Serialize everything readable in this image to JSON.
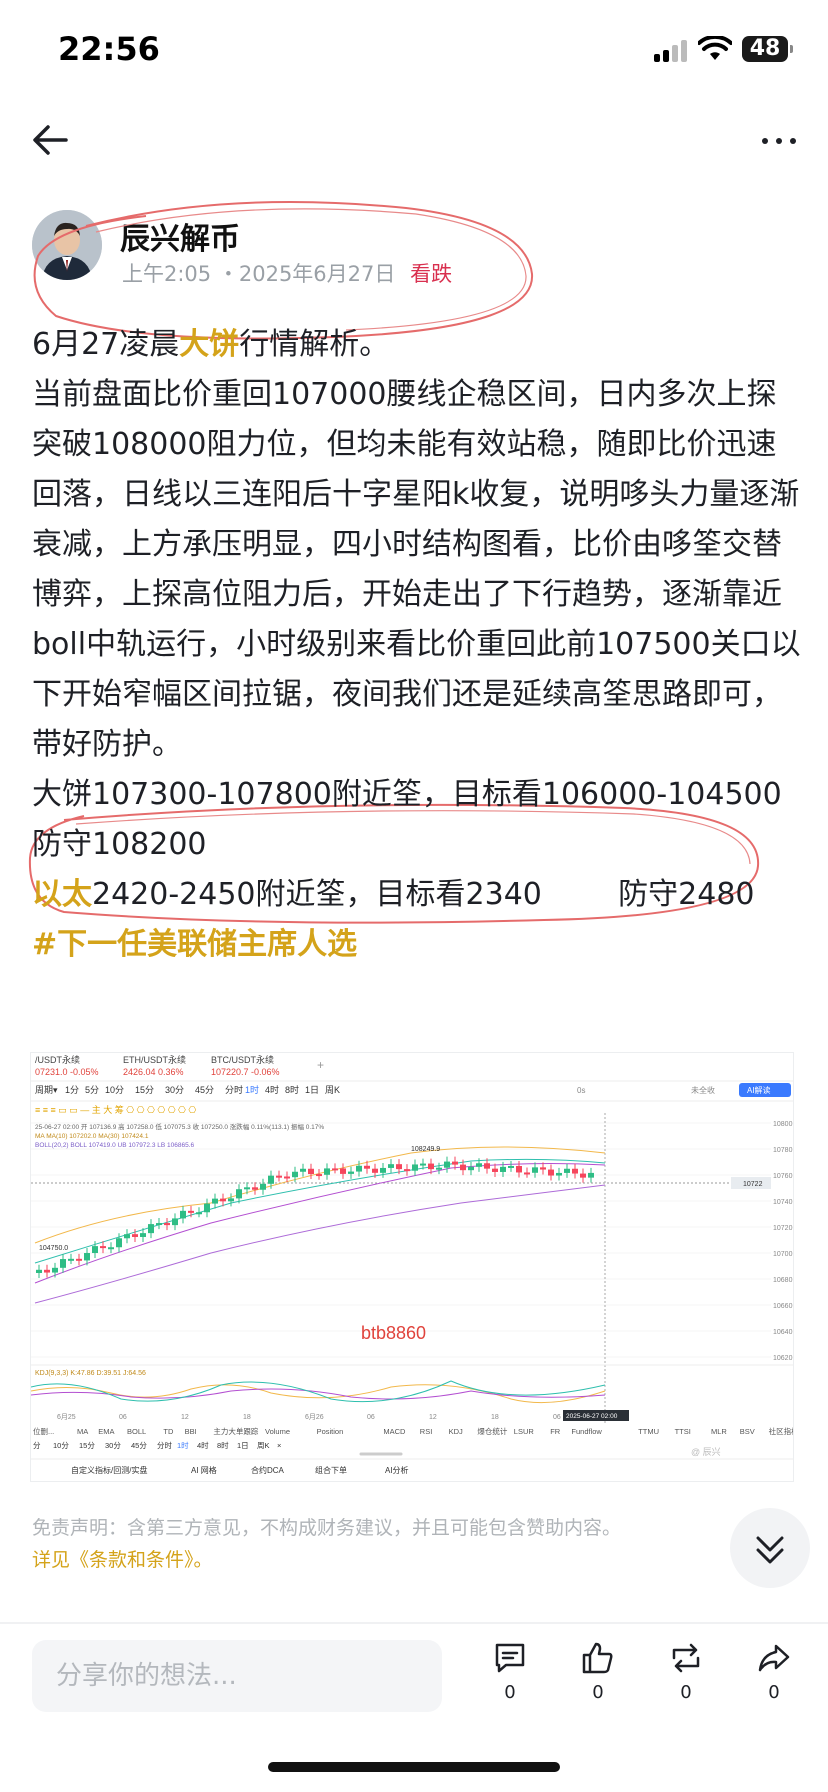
{
  "status_bar": {
    "time": "22:56",
    "battery": "48"
  },
  "author": {
    "name": "辰兴解币",
    "time": "上午2:05",
    "date": "・2025年6月27日",
    "sentiment": "看跌"
  },
  "post": {
    "title_pre": "6月27凌晨",
    "title_highlight": "大饼",
    "title_post": "行情解析。",
    "body": "当前盘面比价重回107000腰线企稳区间，日内多次上探突破108000阻力位，但均未能有效站稳，随即比价迅速回落，日线以三连阳后十字星阳k收复，说明哆头力量逐渐衰减，上方承压明显，四小时结构图看，比价由哆筌交替博弈，上探高位阻力后，开始走出了下行趋势，逐渐靠近boll中轨运行，小时级别来看比价重回此前107500关口以下开始窄幅区间拉锯，夜间我们还是延续高筌思路即可，带好防护。",
    "btc_plan": "大饼107300-107800附近筌，目标看106000-104500  防守108200",
    "eth_label": "以太",
    "eth_plan": "2420-2450附近筌，目标看2340        防守2480",
    "hashtag": "#下一任美联储主席人选"
  },
  "chart": {
    "tabs": [
      {
        "symbol": "/USDT永续",
        "price": "07231.0 -0.05%"
      },
      {
        "symbol": "ETH/USDT永续",
        "price": "2426.04 0.36%"
      },
      {
        "symbol": "BTC/USDT永续",
        "price": "107220.7 -0.06%"
      }
    ],
    "add_tab": "+",
    "timeframes": [
      "周期▾",
      "1分",
      "5分",
      "10分",
      "15分",
      "30分",
      "45分",
      "分时",
      "1时",
      "4时",
      "8时",
      "1日",
      "周K"
    ],
    "ohlc": "25-06-27 02:00   开 107136.9  高 107258.0  低 107075.3  收 107250.0  涨跌幅 0.11%(113.1)  振幅 0.17%",
    "ma_line": "MA   MA(10) 107202.0   MA(30) 107424.1",
    "boll_line": "BOLL(20,2)  BOLL 107419.0   UB 107972.3   LB 106865.6",
    "high_label": "108249.9",
    "low_label": "104750.0",
    "watermark": "btb8860",
    "price_ticks": [
      "10800",
      "10780",
      "10760",
      "10740",
      "10720",
      "10700",
      "10680",
      "10660",
      "10640",
      "10620"
    ],
    "current_price": "10722",
    "kdj_line": "KDJ(9,3,3)  K:47.86  D:39.51  J:64.56",
    "date_labels": [
      "6月25",
      "06",
      "12",
      "18",
      "6月26",
      "06",
      "12",
      "18",
      "06",
      "12"
    ],
    "date_highlight": "2025-06-27 02:00",
    "indicators": [
      "位删...",
      "MA",
      "EMA",
      "BOLL",
      "TD",
      "BBI",
      "主力大单跟踪",
      "Volume",
      "Position",
      "MACD",
      "RSI",
      "KDJ",
      "爆仓统计",
      "LSUR",
      "FR",
      "Fundflow",
      "TTMU",
      "TTSI",
      "MLR",
      "BSV",
      "社区指标",
      "对数",
      "%"
    ],
    "bottom_timeframes": [
      "分",
      "10分",
      "15分",
      "30分",
      "45分",
      "分时",
      "1时",
      "4时",
      "8时",
      "1日",
      "周K",
      "×"
    ],
    "bottom_menu": [
      "自定义指标/回测/实盘",
      "AI 网格",
      "合约DCA",
      "组合下单",
      "AI分析"
    ],
    "right_controls": [
      "0s",
      "未全收",
      "AI解读"
    ],
    "corner_watermark": "@ 辰兴",
    "chart_data": {
      "type": "candlestick",
      "symbol": "BTC/USDT永续",
      "interval": "1时",
      "high": 108249.9,
      "low": 104750.0,
      "last": 107220.7
    }
  },
  "disclaimer": {
    "text": "免责声明：含第三方意见，不构成财务建议，并且可能包含赞助内容。",
    "link": "详见《条款和条件》。"
  },
  "bottom_bar": {
    "placeholder": "分享你的想法...",
    "comments": "0",
    "likes": "0",
    "reposts": "0",
    "shares": "0"
  }
}
